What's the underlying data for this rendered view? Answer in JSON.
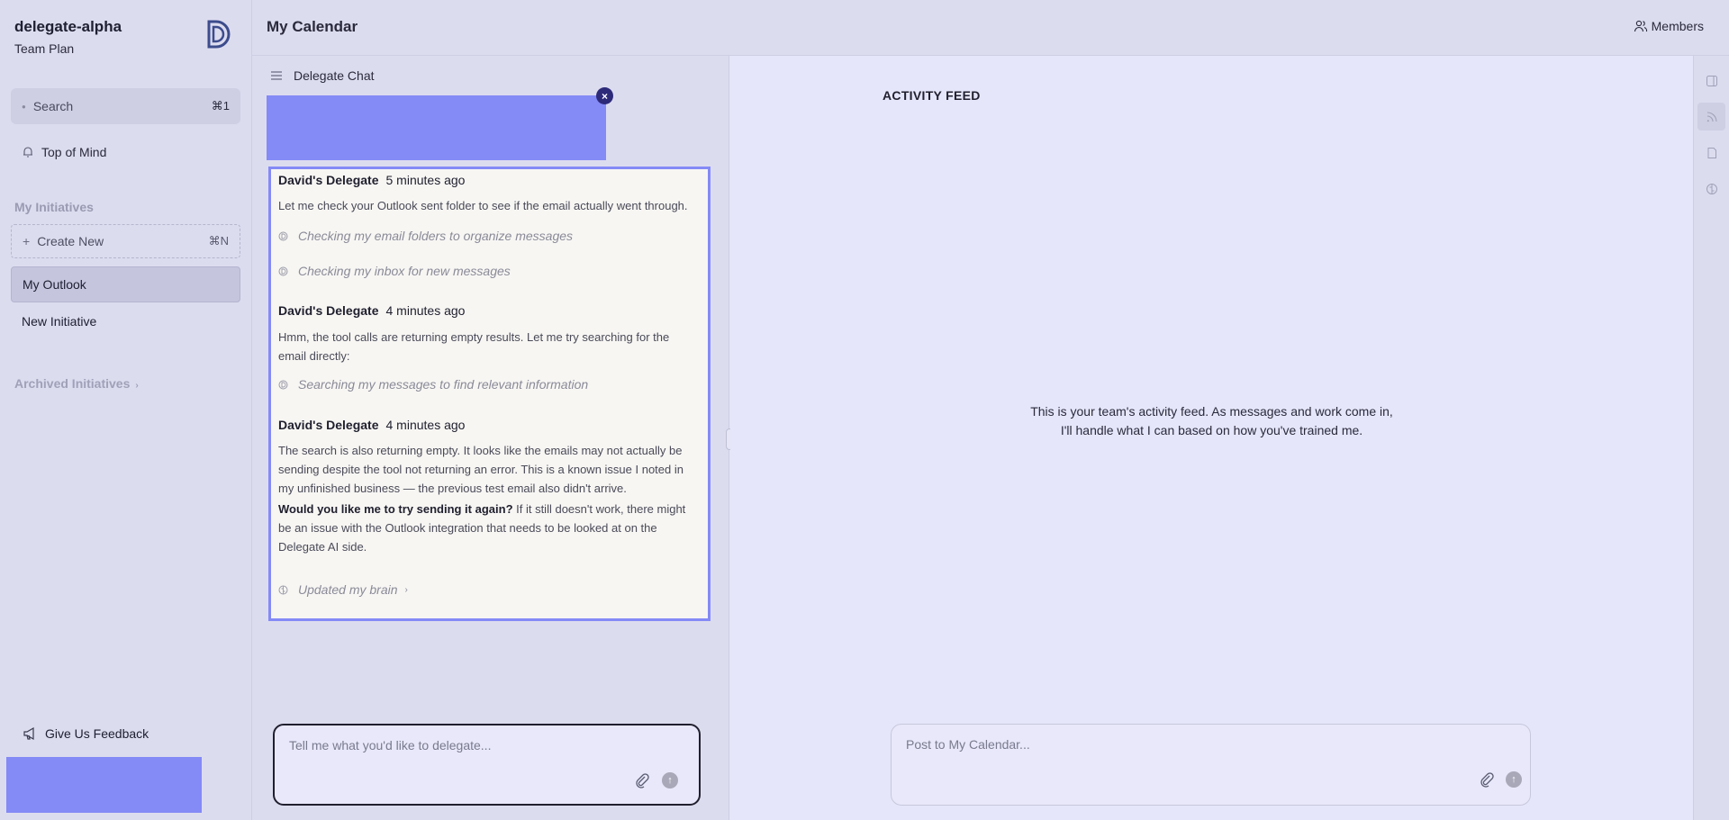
{
  "sidebar": {
    "workspace_name": "delegate-alpha",
    "plan": "Team Plan",
    "search": {
      "label": "Search",
      "shortcut": "⌘1"
    },
    "top_of_mind": "Top of Mind",
    "initiatives_heading": "My Initiatives",
    "create_new": {
      "label": "Create New",
      "shortcut": "⌘N"
    },
    "initiatives": [
      {
        "label": "My Outlook",
        "active": true
      },
      {
        "label": "New Initiative",
        "active": false
      }
    ],
    "archived_label": "Archived Initiatives",
    "feedback_label": "Give Us Feedback"
  },
  "header": {
    "title": "My Calendar",
    "members_label": "Members"
  },
  "chat": {
    "title": "Delegate Chat",
    "messages": [
      {
        "author": "David's Delegate",
        "time": "5 minutes ago",
        "text": "Let me check your Outlook sent folder to see if the email actually went through.",
        "tools": [
          "Checking my email folders to organize messages",
          "Checking my inbox for new messages"
        ]
      },
      {
        "author": "David's Delegate",
        "time": "4 minutes ago",
        "text": "Hmm, the tool calls are returning empty results. Let me try searching for the email directly:",
        "tools": [
          "Searching my messages to find relevant information"
        ]
      },
      {
        "author": "David's Delegate",
        "time": "4 minutes ago",
        "text": "The search is also returning empty. It looks like the emails may not actually be sending despite the tool not returning an error. This is a known issue I noted in my unfinished business — the previous test email also didn't arrive.",
        "bold_text": "Would you like me to try sending it again?",
        "text_after": " If it still doesn't work, there might be an issue with the Outlook integration that needs to be looked at on the Delegate AI side.",
        "tools": [
          "Updated my brain"
        ]
      }
    ],
    "input_placeholder": "Tell me what you'd like to delegate..."
  },
  "feed": {
    "title": "ACTIVITY FEED",
    "empty_line1": "This is your team's activity feed. As messages and work come in,",
    "empty_line2": "I'll handle what I can based on how you've trained me.",
    "input_placeholder": "Post to My Calendar..."
  },
  "colors": {
    "accent": "#848af6",
    "close_button": "#2d2a7a",
    "sidebar_bg": "#dcdcef",
    "feed_bg": "#e6e6fa"
  },
  "icons": {
    "logo": "delegate-logo",
    "search": "search-icon",
    "top_of_mind": "bell-icon",
    "members": "users-icon",
    "feedback": "megaphone-icon",
    "chat_menu": "menu-icon",
    "tool": "delegate-mini-icon",
    "brain": "brain-icon",
    "attach": "paperclip-icon",
    "send": "send-icon",
    "rail": [
      "panel-toggle-icon",
      "rss-icon",
      "file-icon",
      "brain-icon"
    ]
  }
}
